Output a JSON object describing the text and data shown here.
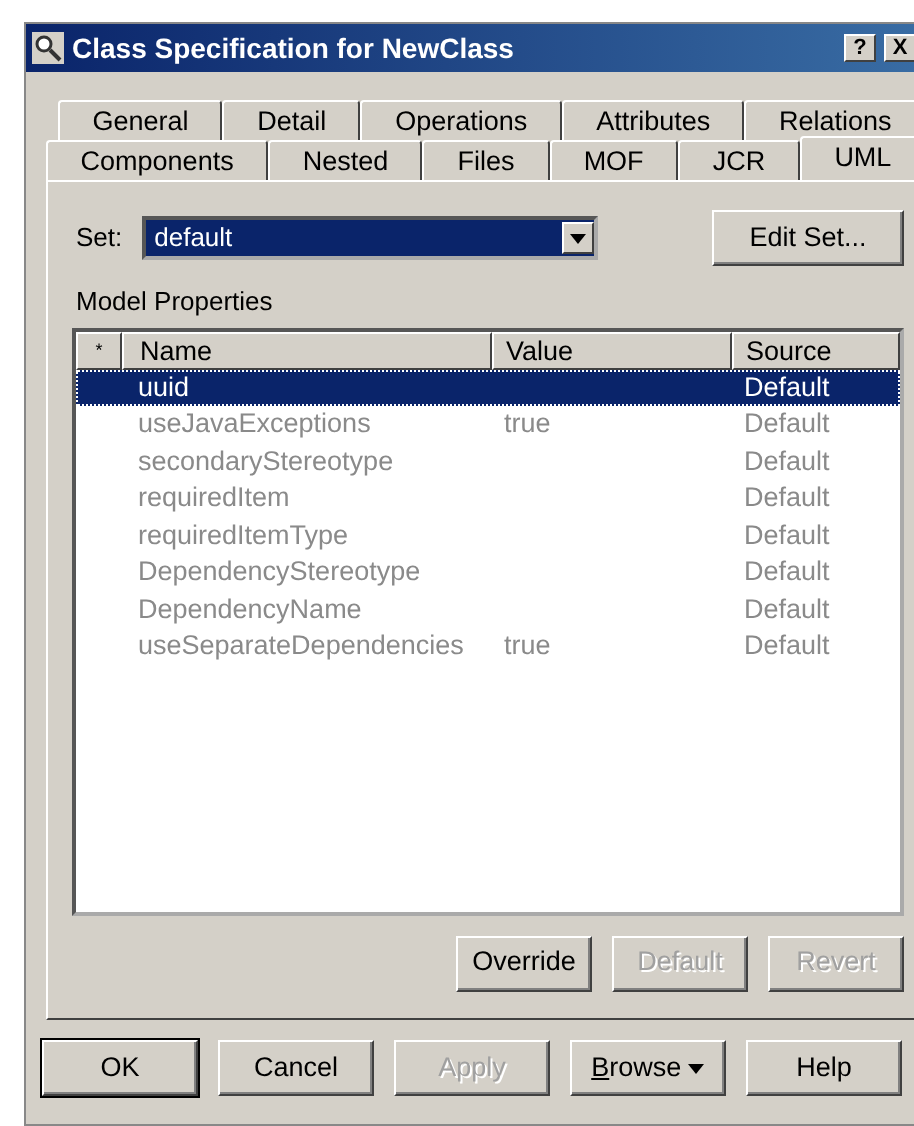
{
  "window": {
    "title": "Class Specification for NewClass",
    "title_buttons": [
      "?",
      "X"
    ]
  },
  "tab_rows": [
    [
      {
        "label": "General",
        "selected": false
      },
      {
        "label": "Detail",
        "selected": false
      },
      {
        "label": "Operations",
        "selected": false
      },
      {
        "label": "Attributes",
        "selected": false
      },
      {
        "label": "Relations",
        "selected": false
      }
    ],
    [
      {
        "label": "Components",
        "selected": false
      },
      {
        "label": "Nested",
        "selected": false
      },
      {
        "label": "Files",
        "selected": false
      },
      {
        "label": "MOF",
        "selected": false
      },
      {
        "label": "JCR",
        "selected": false
      },
      {
        "label": "UML",
        "selected": true
      }
    ]
  ],
  "set": {
    "label": "Set:",
    "value": "default",
    "button": "Edit Set..."
  },
  "properties": {
    "label": "Model Properties",
    "columns": [
      "*",
      "Name",
      "Value",
      "Source"
    ],
    "rows": [
      {
        "name": "uuid",
        "value": "",
        "source": "Default",
        "selected": true
      },
      {
        "name": "useJavaExceptions",
        "value": "true",
        "source": "Default",
        "selected": false
      },
      {
        "name": "secondaryStereotype",
        "value": "",
        "source": "Default",
        "selected": false
      },
      {
        "name": "requiredItem",
        "value": "",
        "source": "Default",
        "selected": false
      },
      {
        "name": "requiredItemType",
        "value": "",
        "source": "Default",
        "selected": false
      },
      {
        "name": "DependencyStereotype",
        "value": "",
        "source": "Default",
        "selected": false
      },
      {
        "name": "DependencyName",
        "value": "",
        "source": "Default",
        "selected": false
      },
      {
        "name": "useSeparateDependencies",
        "value": "true",
        "source": "Default",
        "selected": false
      }
    ]
  },
  "property_buttons": [
    {
      "label": "Override",
      "disabled": false
    },
    {
      "label": "Default",
      "disabled": true
    },
    {
      "label": "Revert",
      "disabled": true
    }
  ],
  "dialog_buttons": [
    {
      "label": "OK",
      "disabled": false,
      "default": true,
      "kind": "plain"
    },
    {
      "label": "Cancel",
      "disabled": false,
      "default": false,
      "kind": "plain"
    },
    {
      "label": "Apply",
      "disabled": true,
      "default": false,
      "kind": "plain"
    },
    {
      "label": "Browse",
      "disabled": false,
      "default": false,
      "kind": "menu"
    },
    {
      "label": "Help",
      "disabled": false,
      "default": false,
      "kind": "plain"
    }
  ]
}
